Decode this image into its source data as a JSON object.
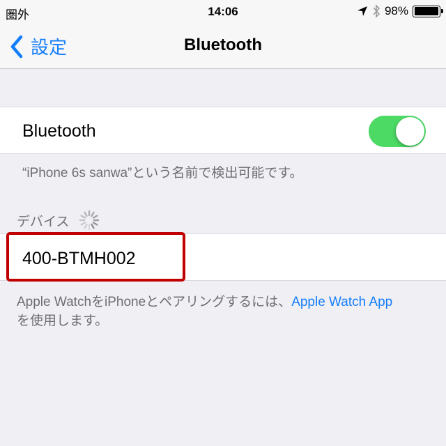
{
  "status_bar": {
    "carrier": "圏外",
    "time": "14:06",
    "battery_percent": "98%",
    "battery_level": 0.98,
    "icons": [
      "location-arrow-icon",
      "bluetooth-icon",
      "battery-icon"
    ]
  },
  "nav": {
    "back_label": "設定",
    "back_icon": "chevron-left-icon",
    "title": "Bluetooth"
  },
  "bluetooth_cell": {
    "label": "Bluetooth",
    "toggle_on": true,
    "toggle_color": "#4cd964"
  },
  "discoverable_footer": "“iPhone 6s sanwa”という名前で検出可能です。",
  "devices_section": {
    "header": "デバイス",
    "spinner_icon": "activity-spinner-icon",
    "items": [
      {
        "name": "400-BTMH002"
      }
    ]
  },
  "watch_footer": {
    "text": "Apple WatchをiPhoneとペアリングするには、",
    "link": "Apple Watch App",
    "text_after": "を使用します。"
  },
  "colors": {
    "accent": "#157efb",
    "highlight": "#c00000",
    "background": "#efeff4"
  }
}
